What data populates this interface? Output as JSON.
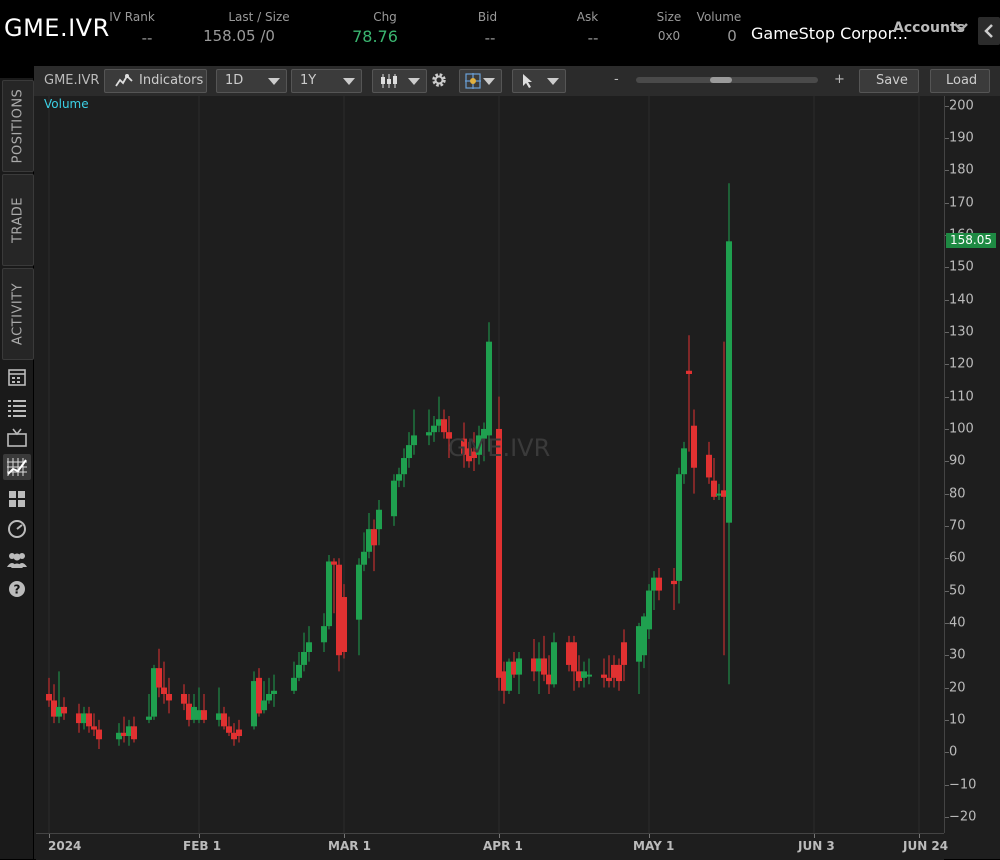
{
  "quote": {
    "symbol": "GME.IVR",
    "iv_rank_label": "IV Rank",
    "iv_rank_value": "--",
    "last_label": "Last / Size",
    "last_value": "158.05 /0",
    "chg_label": "Chg",
    "chg_value": "78.76",
    "bid_label": "Bid",
    "bid_value": "--",
    "ask_label": "Ask",
    "ask_value": "--",
    "size_label": "Size",
    "size_value": "0x0",
    "volume_label": "Volume",
    "volume_value": "0",
    "company": "GameStop Corpor...",
    "accounts_label": "Accounts"
  },
  "rail": {
    "tabs": [
      "POSITIONS",
      "TRADE",
      "ACTIVITY"
    ]
  },
  "toolbar": {
    "symbol": "GME.IVR",
    "indicators_label": "Indicators",
    "aggregation": "1D",
    "time_frame": "1Y",
    "zoom_minus": "-",
    "zoom_plus": "+",
    "save_label": "Save",
    "load_label": "Load"
  },
  "chart": {
    "volume_label": "Volume",
    "watermark": "GME.IVR",
    "current_price_tag": "158.05",
    "colors": {
      "up": "#1fa04f",
      "down": "#e03131",
      "price_tag": "#1e8a43",
      "volume_label": "#3cd1e6"
    }
  },
  "chart_data": {
    "type": "candlestick",
    "ylim": [
      -25,
      203
    ],
    "y_ticks": [
      200,
      190,
      180,
      170,
      160,
      150,
      140,
      130,
      120,
      110,
      100,
      90,
      80,
      70,
      60,
      50,
      40,
      30,
      20,
      10,
      0,
      -10,
      -20
    ],
    "x_ticks": [
      "2024",
      "FEB 1",
      "MAR 1",
      "APR 1",
      "MAY 1",
      "JUN 3",
      "JUN 24"
    ],
    "x_tick_dates": [
      "2024-01-02",
      "2024-02-01",
      "2024-03-01",
      "2024-04-01",
      "2024-05-01",
      "2024-06-03",
      "2024-06-24"
    ],
    "x_axis_end": "2024-06-29",
    "last_price": 158.05,
    "candles": [
      {
        "d": "2024-01-02",
        "o": 18,
        "h": 23,
        "l": 14,
        "c": 16
      },
      {
        "d": "2024-01-03",
        "o": 16,
        "h": 21,
        "l": 9,
        "c": 11
      },
      {
        "d": "2024-01-04",
        "o": 11,
        "h": 25,
        "l": 9,
        "c": 14
      },
      {
        "d": "2024-01-05",
        "o": 14,
        "h": 17,
        "l": 10,
        "c": 12
      },
      {
        "d": "2024-01-08",
        "o": 12,
        "h": 15,
        "l": 6,
        "c": 9
      },
      {
        "d": "2024-01-09",
        "o": 9,
        "h": 14,
        "l": 7,
        "c": 12
      },
      {
        "d": "2024-01-10",
        "o": 12,
        "h": 14,
        "l": 6,
        "c": 8
      },
      {
        "d": "2024-01-11",
        "o": 8,
        "h": 12,
        "l": 5,
        "c": 7
      },
      {
        "d": "2024-01-12",
        "o": 7,
        "h": 10,
        "l": 1,
        "c": 4
      },
      {
        "d": "2024-01-16",
        "o": 4,
        "h": 9,
        "l": 2,
        "c": 6
      },
      {
        "d": "2024-01-17",
        "o": 6,
        "h": 11,
        "l": 3,
        "c": 5
      },
      {
        "d": "2024-01-18",
        "o": 5,
        "h": 10,
        "l": 2,
        "c": 8
      },
      {
        "d": "2024-01-19",
        "o": 8,
        "h": 11,
        "l": 3,
        "c": 4
      },
      {
        "d": "2024-01-22",
        "o": 10,
        "h": 18,
        "l": 9,
        "c": 11
      },
      {
        "d": "2024-01-23",
        "o": 11,
        "h": 27,
        "l": 10,
        "c": 26
      },
      {
        "d": "2024-01-24",
        "o": 26,
        "h": 32,
        "l": 17,
        "c": 20
      },
      {
        "d": "2024-01-25",
        "o": 20,
        "h": 28,
        "l": 15,
        "c": 18
      },
      {
        "d": "2024-01-26",
        "o": 18,
        "h": 23,
        "l": 12,
        "c": 16
      },
      {
        "d": "2024-01-29",
        "o": 18,
        "h": 21,
        "l": 13,
        "c": 15
      },
      {
        "d": "2024-01-30",
        "o": 15,
        "h": 18,
        "l": 8,
        "c": 10
      },
      {
        "d": "2024-01-31",
        "o": 10,
        "h": 18,
        "l": 9,
        "c": 14
      },
      {
        "d": "2024-02-01",
        "o": 10,
        "h": 20,
        "l": 9,
        "c": 13
      },
      {
        "d": "2024-02-02",
        "o": 13,
        "h": 18,
        "l": 9,
        "c": 10
      },
      {
        "d": "2024-02-05",
        "o": 10,
        "h": 20,
        "l": 8,
        "c": 12
      },
      {
        "d": "2024-02-06",
        "o": 12,
        "h": 14,
        "l": 7,
        "c": 8
      },
      {
        "d": "2024-02-07",
        "o": 8,
        "h": 11,
        "l": 5,
        "c": 6
      },
      {
        "d": "2024-02-08",
        "o": 6,
        "h": 9,
        "l": 2,
        "c": 4
      },
      {
        "d": "2024-02-09",
        "o": 7,
        "h": 10,
        "l": 3,
        "c": 5
      },
      {
        "d": "2024-02-12",
        "o": 8,
        "h": 25,
        "l": 7,
        "c": 22
      },
      {
        "d": "2024-02-13",
        "o": 23,
        "h": 26,
        "l": 11,
        "c": 12
      },
      {
        "d": "2024-02-14",
        "o": 13,
        "h": 22,
        "l": 12,
        "c": 16
      },
      {
        "d": "2024-02-15",
        "o": 16,
        "h": 23,
        "l": 15,
        "c": 18
      },
      {
        "d": "2024-02-16",
        "o": 18,
        "h": 24,
        "l": 14,
        "c": 19
      },
      {
        "d": "2024-02-20",
        "o": 19,
        "h": 28,
        "l": 18,
        "c": 23
      },
      {
        "d": "2024-02-21",
        "o": 23,
        "h": 31,
        "l": 22,
        "c": 27
      },
      {
        "d": "2024-02-22",
        "o": 27,
        "h": 37,
        "l": 25,
        "c": 31
      },
      {
        "d": "2024-02-23",
        "o": 31,
        "h": 39,
        "l": 28,
        "c": 34
      },
      {
        "d": "2024-02-26",
        "o": 34,
        "h": 43,
        "l": 31,
        "c": 39
      },
      {
        "d": "2024-02-27",
        "o": 39,
        "h": 61,
        "l": 38,
        "c": 59
      },
      {
        "d": "2024-02-28",
        "o": 59,
        "h": 60,
        "l": 43,
        "c": 58
      },
      {
        "d": "2024-02-29",
        "o": 58,
        "h": 60,
        "l": 25,
        "c": 30
      },
      {
        "d": "2024-03-01",
        "o": 48,
        "h": 52,
        "l": 29,
        "c": 31
      },
      {
        "d": "2024-03-04",
        "o": 41,
        "h": 60,
        "l": 30,
        "c": 58
      },
      {
        "d": "2024-03-05",
        "o": 58,
        "h": 68,
        "l": 56,
        "c": 62
      },
      {
        "d": "2024-03-06",
        "o": 62,
        "h": 74,
        "l": 60,
        "c": 69
      },
      {
        "d": "2024-03-07",
        "o": 69,
        "h": 72,
        "l": 56,
        "c": 64
      },
      {
        "d": "2024-03-08",
        "o": 69,
        "h": 78,
        "l": 64,
        "c": 75
      },
      {
        "d": "2024-03-11",
        "o": 73,
        "h": 86,
        "l": 70,
        "c": 84
      },
      {
        "d": "2024-03-12",
        "o": 84,
        "h": 88,
        "l": 82,
        "c": 86
      },
      {
        "d": "2024-03-13",
        "o": 86,
        "h": 94,
        "l": 82,
        "c": 91
      },
      {
        "d": "2024-03-14",
        "o": 91,
        "h": 99,
        "l": 88,
        "c": 95
      },
      {
        "d": "2024-03-15",
        "o": 95,
        "h": 106,
        "l": 92,
        "c": 98
      },
      {
        "d": "2024-03-18",
        "o": 98,
        "h": 106,
        "l": 95,
        "c": 99
      },
      {
        "d": "2024-03-19",
        "o": 99,
        "h": 104,
        "l": 96,
        "c": 101
      },
      {
        "d": "2024-03-20",
        "o": 101,
        "h": 110,
        "l": 99,
        "c": 103
      },
      {
        "d": "2024-03-21",
        "o": 103,
        "h": 106,
        "l": 97,
        "c": 99
      },
      {
        "d": "2024-03-22",
        "o": 99,
        "h": 104,
        "l": 91,
        "c": 97
      },
      {
        "d": "2024-03-25",
        "o": 97,
        "h": 102,
        "l": 88,
        "c": 92
      },
      {
        "d": "2024-03-26",
        "o": 94,
        "h": 96,
        "l": 88,
        "c": 90
      },
      {
        "d": "2024-03-27",
        "o": 93,
        "h": 99,
        "l": 87,
        "c": 91
      },
      {
        "d": "2024-03-28",
        "o": 92,
        "h": 101,
        "l": 89,
        "c": 98
      },
      {
        "d": "2024-03-29",
        "o": 97,
        "h": 102,
        "l": 90,
        "c": 100
      },
      {
        "d": "2024-03-30",
        "o": 98,
        "h": 133,
        "l": 93,
        "c": 127
      },
      {
        "d": "2024-04-01",
        "o": 100,
        "h": 110,
        "l": 19,
        "c": 23
      },
      {
        "d": "2024-04-02",
        "o": 25,
        "h": 28,
        "l": 15,
        "c": 19
      },
      {
        "d": "2024-04-03",
        "o": 19,
        "h": 29,
        "l": 18,
        "c": 28
      },
      {
        "d": "2024-04-04",
        "o": 28,
        "h": 31,
        "l": 23,
        "c": 24
      },
      {
        "d": "2024-04-05",
        "o": 24,
        "h": 31,
        "l": 18,
        "c": 29
      },
      {
        "d": "2024-04-08",
        "o": 29,
        "h": 35,
        "l": 22,
        "c": 25
      },
      {
        "d": "2024-04-09",
        "o": 25,
        "h": 34,
        "l": 18,
        "c": 29
      },
      {
        "d": "2024-04-10",
        "o": 29,
        "h": 36,
        "l": 22,
        "c": 24
      },
      {
        "d": "2024-04-11",
        "o": 24,
        "h": 30,
        "l": 18,
        "c": 21
      },
      {
        "d": "2024-04-12",
        "o": 21,
        "h": 37,
        "l": 20,
        "c": 34
      },
      {
        "d": "2024-04-15",
        "o": 34,
        "h": 36,
        "l": 25,
        "c": 27
      },
      {
        "d": "2024-04-16",
        "o": 34,
        "h": 36,
        "l": 19,
        "c": 25
      },
      {
        "d": "2024-04-17",
        "o": 25,
        "h": 30,
        "l": 20,
        "c": 22
      },
      {
        "d": "2024-04-18",
        "o": 23,
        "h": 28,
        "l": 20,
        "c": 25
      },
      {
        "d": "2024-04-19",
        "o": 24,
        "h": 29,
        "l": 21,
        "c": 24
      },
      {
        "d": "2024-04-22",
        "o": 24,
        "h": 29,
        "l": 20,
        "c": 23
      },
      {
        "d": "2024-04-23",
        "o": 23,
        "h": 30,
        "l": 20,
        "c": 22
      },
      {
        "d": "2024-04-24",
        "o": 27,
        "h": 30,
        "l": 20,
        "c": 23
      },
      {
        "d": "2024-04-25",
        "o": 27,
        "h": 29,
        "l": 19,
        "c": 22
      },
      {
        "d": "2024-04-26",
        "o": 34,
        "h": 38,
        "l": 22,
        "c": 27
      },
      {
        "d": "2024-04-29",
        "o": 28,
        "h": 40,
        "l": 18,
        "c": 39
      },
      {
        "d": "2024-04-30",
        "o": 30,
        "h": 43,
        "l": 26,
        "c": 42
      },
      {
        "d": "2024-05-01",
        "o": 38,
        "h": 52,
        "l": 35,
        "c": 50
      },
      {
        "d": "2024-05-02",
        "o": 50,
        "h": 56,
        "l": 44,
        "c": 54
      },
      {
        "d": "2024-05-03",
        "o": 54,
        "h": 57,
        "l": 47,
        "c": 50
      },
      {
        "d": "2024-05-06",
        "o": 53,
        "h": 57,
        "l": 44,
        "c": 52
      },
      {
        "d": "2024-05-07",
        "o": 53,
        "h": 88,
        "l": 46,
        "c": 86
      },
      {
        "d": "2024-05-08",
        "o": 86,
        "h": 96,
        "l": 83,
        "c": 94
      },
      {
        "d": "2024-05-09",
        "o": 118,
        "h": 129,
        "l": 93,
        "c": 117
      },
      {
        "d": "2024-05-10",
        "o": 101,
        "h": 106,
        "l": 80,
        "c": 88
      },
      {
        "d": "2024-05-13",
        "o": 92,
        "h": 96,
        "l": 83,
        "c": 85
      },
      {
        "d": "2024-05-14",
        "o": 84,
        "h": 91,
        "l": 78,
        "c": 79
      },
      {
        "d": "2024-05-15",
        "o": 80,
        "h": 83,
        "l": 78,
        "c": 80
      },
      {
        "d": "2024-05-16",
        "o": 81,
        "h": 127,
        "l": 30,
        "c": 79
      },
      {
        "d": "2024-05-17",
        "o": 71,
        "h": 176,
        "l": 21,
        "c": 158.05
      }
    ]
  }
}
